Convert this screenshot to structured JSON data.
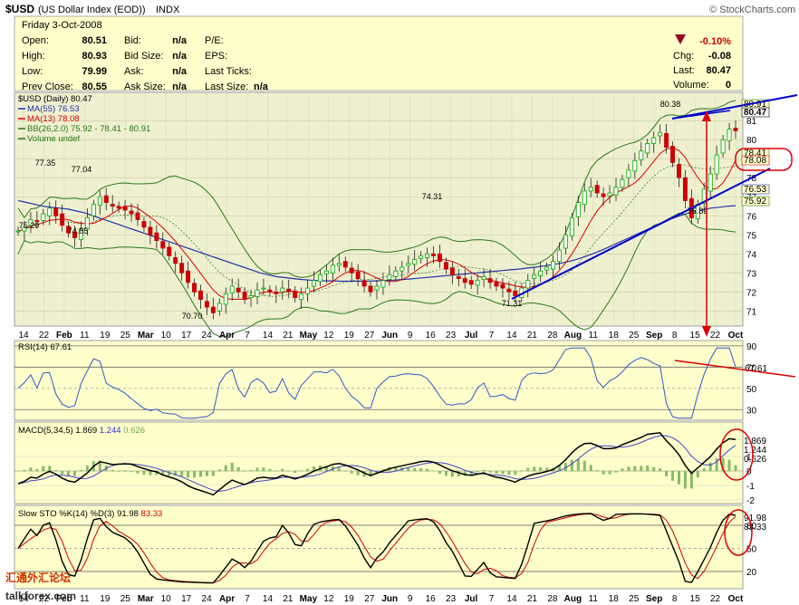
{
  "header": {
    "symbol": "$USD",
    "name": "(US Dollar Index (EOD))",
    "exchange": "INDX",
    "copyright": "© StockCharts.com",
    "date_line": "Friday   3-Oct-2008"
  },
  "quote": {
    "rows": [
      {
        "l1": "Open:",
        "v1": "80.51",
        "l2": "Bid:",
        "v2": "n/a",
        "l3": "P/E:",
        "v3": ""
      },
      {
        "l1": "High:",
        "v1": "80.93",
        "l2": "Bid Size:",
        "v2": "n/a",
        "l3": "EPS:",
        "v3": ""
      },
      {
        "l1": "Low:",
        "v1": "79.99",
        "l2": "Ask:",
        "v2": "n/a",
        "l3": "Last Ticks:",
        "v3": ""
      },
      {
        "l1": "Prev Close:",
        "v1": "80.55",
        "l2": "Ask Size:",
        "v2": "n/a",
        "l3": "Last Size:",
        "v3": "n/a"
      }
    ],
    "change_pct": "-0.10%",
    "right": [
      {
        "label": "Chg:",
        "value": "-0.08"
      },
      {
        "label": "Last:",
        "value": "80.47"
      },
      {
        "label": "Volume:",
        "value": "0"
      }
    ]
  },
  "colors": {
    "panel_bg": "#ffffcc",
    "price_bg": "#eef0d0",
    "up": "#00aa00",
    "down": "#cc0000",
    "ma55": "#2233aa",
    "ma13": "#dd0000",
    "bb": "#2a7a1a",
    "annotation": "#0000cc",
    "circle": "#dd0000"
  },
  "chart_data": [
    {
      "type": "candlestick",
      "legend": [
        {
          "text": "$USD (Daily) 80.47",
          "color": "#000000"
        },
        {
          "text": "MA(55) 76.53",
          "color": "#2233aa"
        },
        {
          "text": "MA(13) 78.08",
          "color": "#dd0000"
        },
        {
          "text": "BB(26,2.0) 75.92 - 78.41 - 80.91",
          "color": "#2a7a1a"
        },
        {
          "text": "Volume undef",
          "color": "#2a7a1a"
        }
      ],
      "ylim": [
        70.3,
        82.2
      ],
      "y_ticks": [
        71,
        72,
        73,
        74,
        75,
        76,
        77,
        78,
        79,
        80,
        81
      ],
      "x_labels": [
        "14",
        "22",
        "Feb",
        "11",
        "19",
        "25",
        "Mar",
        "10",
        "17",
        "24",
        "Apr",
        "7",
        "14",
        "21",
        "May",
        "12",
        "19",
        "27",
        "Jun",
        "9",
        "16",
        "23",
        "Jul",
        "7",
        "14",
        "21",
        "28",
        "Aug",
        "11",
        "18",
        "25",
        "Sep",
        "8",
        "15",
        "22",
        "Oct"
      ],
      "right_labels": [
        "80.91",
        "80.47",
        "78.41",
        "78.08",
        "76.53",
        "75.92"
      ],
      "annotations": [
        "77.35",
        "77.04",
        "75.20",
        "74.85",
        "70.70",
        "74.31",
        "71.31",
        "80.38",
        "75.89"
      ],
      "close": [
        75.2,
        75.4,
        75.8,
        75.7,
        76.1,
        76.4,
        76.0,
        75.5,
        75.1,
        74.85,
        75.3,
        75.9,
        76.6,
        77.0,
        76.7,
        76.5,
        76.4,
        76.3,
        76.1,
        75.8,
        75.4,
        75.0,
        74.7,
        74.3,
        73.9,
        73.5,
        73.0,
        72.5,
        72.0,
        71.6,
        71.2,
        70.9,
        71.4,
        71.9,
        72.3,
        72.0,
        71.6,
        71.8,
        72.1,
        72.2,
        72.0,
        71.9,
        72.2,
        72.0,
        71.7,
        71.9,
        72.2,
        72.6,
        72.9,
        73.1,
        73.4,
        73.5,
        73.3,
        73.0,
        72.7,
        72.3,
        72.0,
        72.3,
        72.6,
        72.9,
        73.1,
        73.3,
        73.5,
        73.7,
        73.9,
        74.0,
        73.9,
        73.6,
        73.2,
        72.9,
        72.7,
        72.5,
        72.4,
        72.6,
        72.8,
        72.5,
        72.3,
        72.2,
        72.0,
        71.8,
        72.2,
        72.6,
        72.9,
        73.1,
        73.3,
        73.6,
        74.2,
        75.0,
        75.9,
        76.7,
        77.3,
        77.5,
        77.2,
        77.0,
        77.2,
        77.5,
        77.9,
        78.4,
        78.9,
        79.4,
        79.8,
        80.1,
        80.38,
        79.6,
        78.8,
        78.0,
        76.8,
        75.89,
        76.6,
        77.4,
        78.2,
        79.2,
        80.0,
        80.55,
        80.47
      ],
      "ma55": [
        76.8,
        76.7,
        76.6,
        76.5,
        76.45,
        76.4,
        76.35,
        76.25,
        76.15,
        76.0,
        75.85,
        75.7,
        75.55,
        75.4,
        75.25,
        75.1,
        74.95,
        74.8,
        74.65,
        74.5,
        74.35,
        74.2,
        74.05,
        73.9,
        73.75,
        73.6,
        73.45,
        73.3,
        73.15,
        73.0,
        72.9,
        72.8,
        72.75,
        72.7,
        72.65,
        72.62,
        72.6,
        72.58,
        72.57,
        72.56,
        72.56,
        72.56,
        72.57,
        72.58,
        72.6,
        72.62,
        72.65,
        72.68,
        72.72,
        72.76,
        72.8,
        72.84,
        72.88,
        72.92,
        72.96,
        73.0,
        73.04,
        73.08,
        73.12,
        73.16,
        73.2,
        73.25,
        73.3,
        73.36,
        73.43,
        73.5,
        73.6,
        73.72,
        73.86,
        74.02,
        74.2,
        74.4,
        74.6,
        74.8,
        75.0,
        75.2,
        75.4,
        75.6,
        75.8,
        75.95,
        76.1,
        76.2,
        76.3,
        76.4,
        76.45,
        76.5,
        76.53
      ],
      "rsi_levels": [
        90,
        70,
        50,
        30
      ],
      "rsi_legend": "RSI(14) 67.61",
      "rsi_right_label": "67.61",
      "macd_legend": [
        "MACD(5,34,5)",
        "1.869",
        "1.244",
        "0.626"
      ],
      "macd_ticks": [
        "1",
        "0",
        "-1",
        "-2"
      ],
      "macd_right_labels": [
        "1.869",
        "1.244",
        "0.626"
      ],
      "sto_legend": [
        "Slow STO %K(14) %D(3)",
        "91.98",
        "83.33"
      ],
      "sto_ticks": [
        "80",
        "50",
        "20"
      ],
      "sto_right_labels": [
        "91.98",
        "83.33"
      ]
    }
  ],
  "watermark": {
    "cn": "汇通外汇论坛",
    "en": "talkforex.com"
  }
}
